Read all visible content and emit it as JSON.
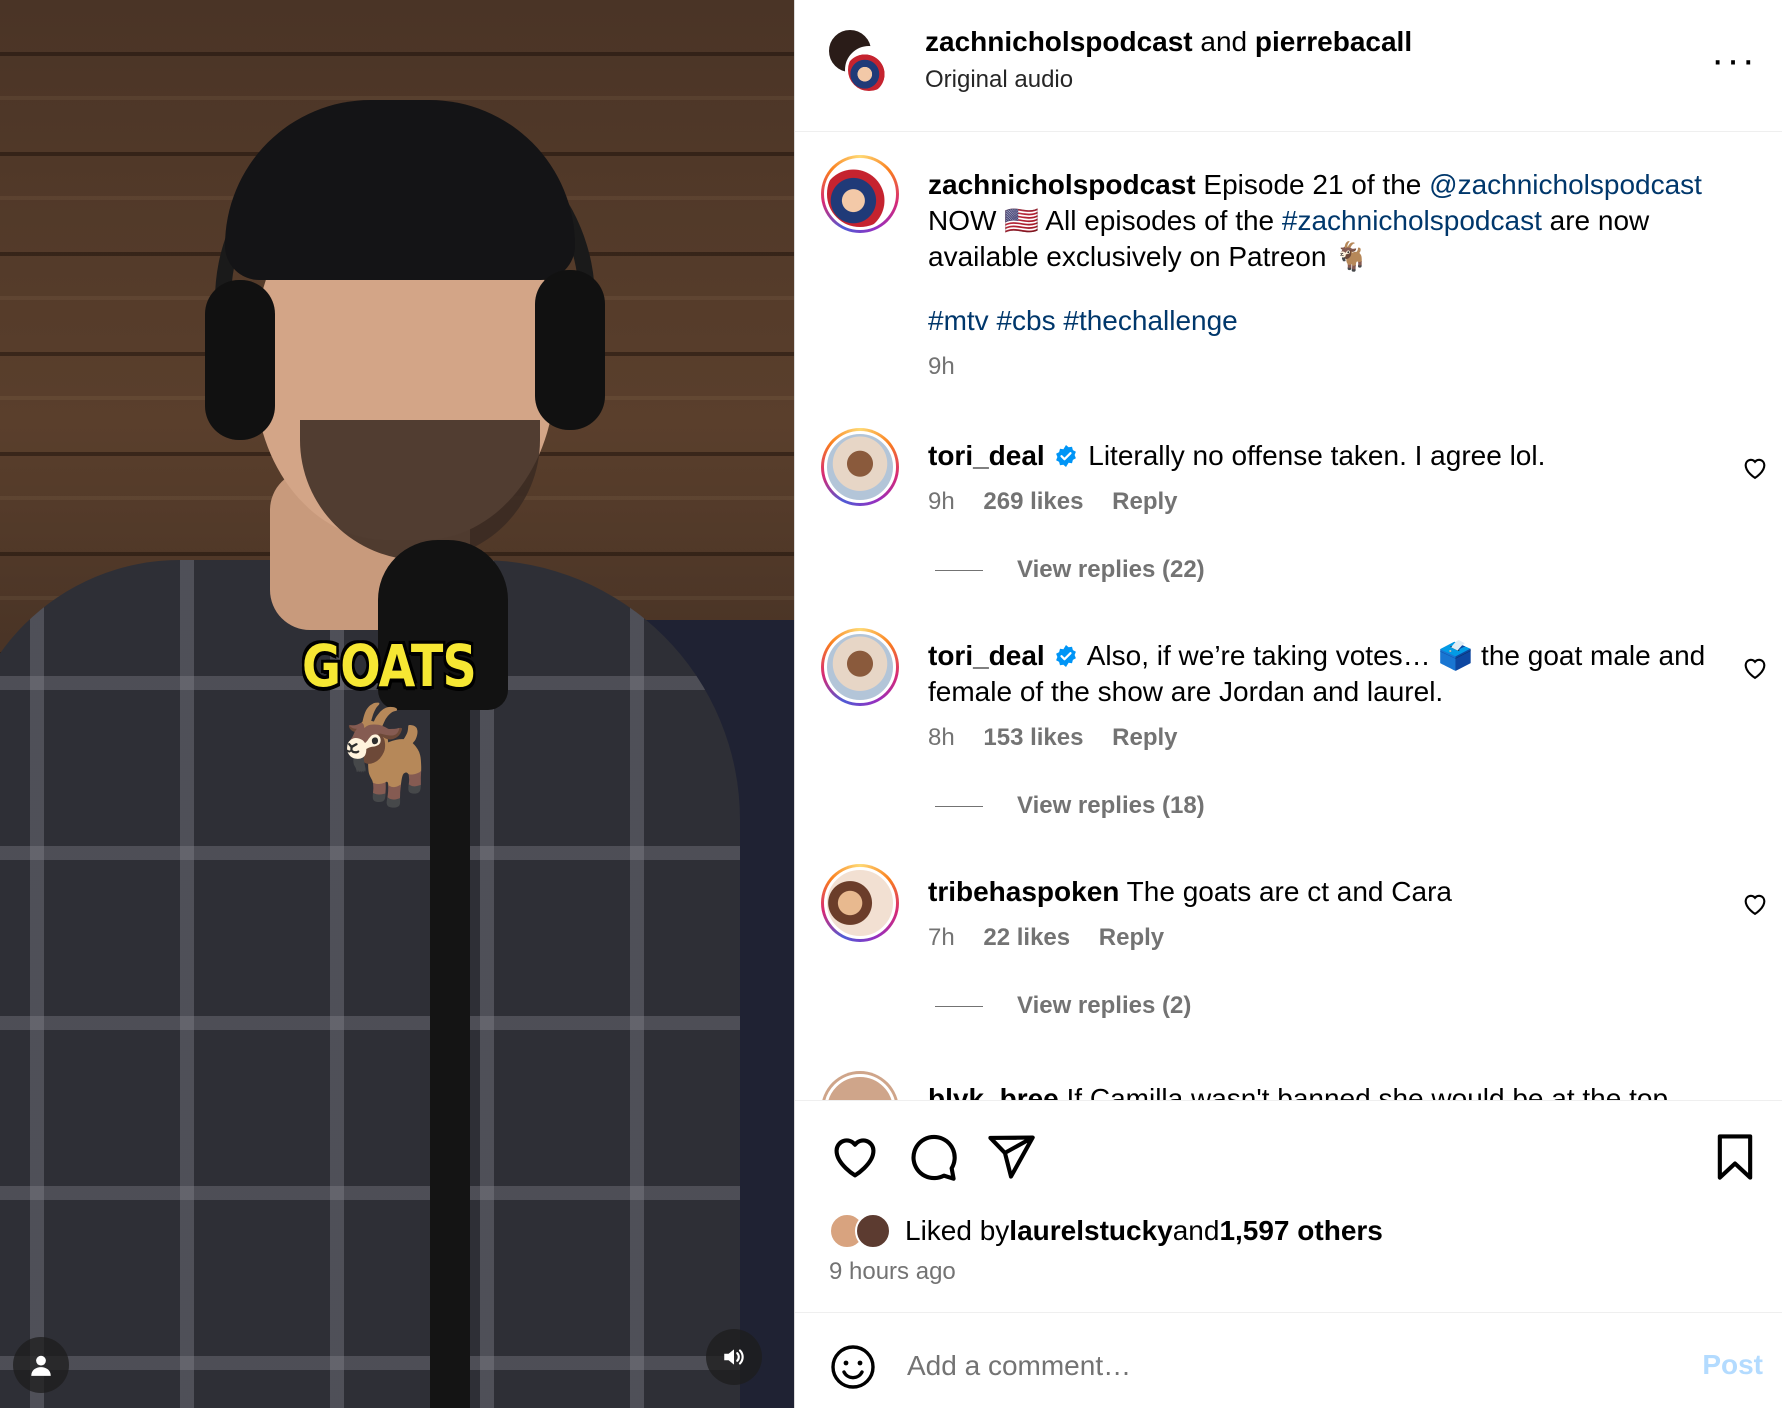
{
  "video": {
    "overlay_text": "GOATS",
    "overlay_emoji": "🐐",
    "user_icon": "person-icon",
    "sound_icon": "speaker-icon"
  },
  "header": {
    "author1": "zachnicholspodcast",
    "joiner": " and ",
    "author2": "pierrebacall",
    "audio": "Original audio",
    "more": "···"
  },
  "caption": {
    "username": "zachnicholspodcast",
    "text1": " Episode 21 of the ",
    "mention": "@zachnicholspodcast",
    "text2": " NOW 🇺🇸 All episodes of the ",
    "hashtag": "#zachnicholspodcast",
    "text3": " are now available exclusively on Patreon 🐐",
    "tags": "#mtv #cbs #thechallenge",
    "time": "9h"
  },
  "comments": [
    {
      "username": "tori_deal",
      "verified": true,
      "text": "Literally no offense taken. I agree lol.",
      "time": "9h",
      "likes": "269 likes",
      "reply": "Reply",
      "view_replies": "View replies (22)"
    },
    {
      "username": "tori_deal",
      "verified": true,
      "text": "Also, if we’re taking votes… 🗳️ the goat male and female of the show are Jordan and laurel.",
      "time": "8h",
      "likes": "153 likes",
      "reply": "Reply",
      "view_replies": "View replies (18)"
    },
    {
      "username": "tribehaspoken",
      "verified": false,
      "text": "The goats are ct and Cara",
      "time": "7h",
      "likes": "22 likes",
      "reply": "Reply",
      "view_replies": "View replies (2)"
    },
    {
      "username": "blyk_bree",
      "verified": false,
      "text": "If Camilla wasn't banned she would be at the top"
    }
  ],
  "actions": {
    "like_icon": "heart-icon",
    "comment_icon": "comment-icon",
    "share_icon": "send-icon",
    "save_icon": "bookmark-icon"
  },
  "likes": {
    "prefix": "Liked by ",
    "user": "laurelstucky",
    "middle": " and ",
    "others": "1,597 others",
    "ago": "9 hours ago"
  },
  "composer": {
    "placeholder": "Add a comment…",
    "post_label": "Post",
    "post_color": "#b3dbff"
  },
  "colors": {
    "link": "#00376b",
    "muted": "#737373",
    "verified": "#0095f6",
    "goats_text": "#f6e733"
  }
}
